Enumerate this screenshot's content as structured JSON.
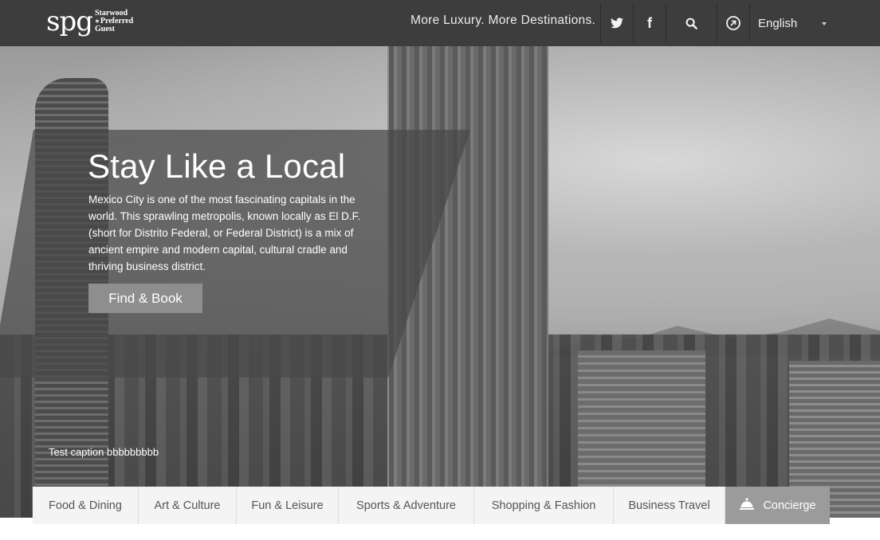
{
  "header": {
    "logo": {
      "mark": "spg",
      "words": [
        "Starwood",
        "Preferred",
        "Guest"
      ]
    },
    "tagline": "More Luxury. More Destinations.",
    "icons": [
      "twitter-icon",
      "facebook-icon",
      "search-icon",
      "spg-badge-icon"
    ],
    "facebook_glyph": "f",
    "language": "English"
  },
  "hero": {
    "title": "Stay Like a Local",
    "body": "Mexico City is one of the most fascinating capitals in the world. This sprawling metropolis, known locally as El D.F. (short for Distrito Federal, or Federal District) is a mix of ancient empire and modern capital, cultural cradle and thriving business district.",
    "cta": "Find & Book",
    "caption": "Test caption bbbbbbbbb"
  },
  "categories": [
    "Food & Dining",
    "Art & Culture",
    "Fun & Leisure",
    "Sports & Adventure",
    "Shopping & Fashion",
    "Business Travel",
    "Concierge"
  ],
  "colors": {
    "topbar": "#3d3d3d",
    "panel": "#484848",
    "cta": "#8e8e8e",
    "concierge": "#9b9b9b",
    "catbar": "#f4f4f4"
  }
}
